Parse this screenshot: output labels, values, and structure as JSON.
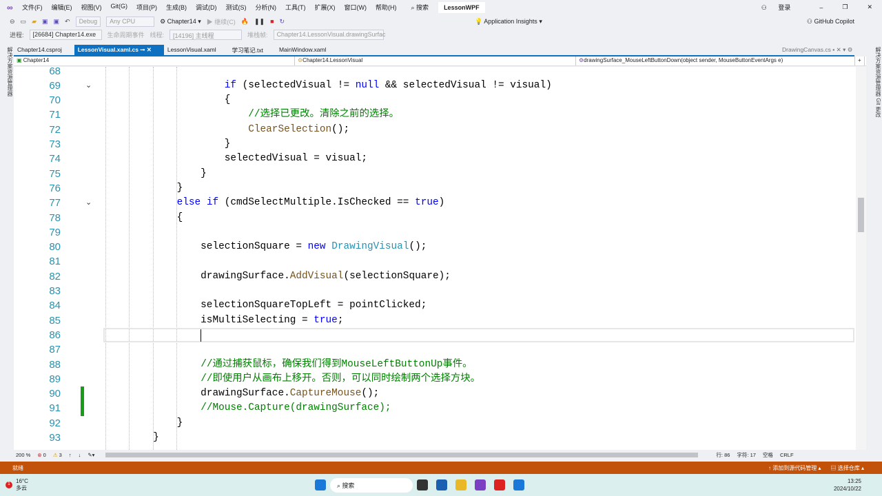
{
  "menu": {
    "items": [
      "文件(F)",
      "编辑(E)",
      "视图(V)",
      "Git(G)",
      "项目(P)",
      "生成(B)",
      "调试(D)",
      "测试(S)",
      "分析(N)",
      "工具(T)",
      "扩展(X)",
      "窗口(W)",
      "帮助(H)"
    ],
    "search": "搜索",
    "solution": "LessonWPF",
    "signin": "登录"
  },
  "toolbar": {
    "config": "Debug",
    "platform": "Any CPU",
    "project": "Chapter14",
    "continue": "继续(C)",
    "app_insights": "Application Insights",
    "copilot": "GitHub Copilot"
  },
  "toolbar2": {
    "process_label": "进程:",
    "process": "[26684] Chapter14.exe",
    "lifecycle": "生命周期事件",
    "thread_label": "线程:",
    "thread": "[14196] 主线程",
    "stackframe_label": "堆栈帧:",
    "stackframe": "Chapter14.LessonVisual.drawingSurfac"
  },
  "tabs": [
    {
      "label": "Chapter14.csproj"
    },
    {
      "label": "LessonVisual.xaml.cs",
      "active": true
    },
    {
      "label": "LessonVisual.xaml"
    },
    {
      "label": "学习笔记.txt"
    },
    {
      "label": "MainWindow.xaml"
    }
  ],
  "preview_tab": "DrawingCanvas.cs",
  "nav": {
    "project": "Chapter14",
    "class": "Chapter14.LessonVisual",
    "member": "drawingSurface_MouseLeftButtonDown(object sender, MouseButtonEventArgs e)"
  },
  "left_strip": "解决方案资源管理器",
  "right_strip": "解决方案资源管理器 Git 更改",
  "code": [
    {
      "n": "68",
      "t": []
    },
    {
      "n": "69",
      "fold": true,
      "t": [
        [
          "                    ",
          "pl"
        ],
        [
          "if",
          "kw"
        ],
        [
          " (selectedVisual != ",
          "pl"
        ],
        [
          "null",
          "kw"
        ],
        [
          " && selectedVisual != ",
          "pl"
        ],
        [
          "visual",
          "pl"
        ],
        [
          ")",
          "pl"
        ]
      ]
    },
    {
      "n": "70",
      "t": [
        [
          "                    {",
          "pl"
        ]
      ]
    },
    {
      "n": "71",
      "t": [
        [
          "                        ",
          "pl"
        ],
        [
          "//选择已更改。清除之前的选择。",
          "cm"
        ]
      ]
    },
    {
      "n": "72",
      "t": [
        [
          "                        ",
          "pl"
        ],
        [
          "ClearSelection",
          "fn"
        ],
        [
          "();",
          "pl"
        ]
      ]
    },
    {
      "n": "73",
      "t": [
        [
          "                    }",
          "pl"
        ]
      ]
    },
    {
      "n": "74",
      "t": [
        [
          "                    selectedVisual = visual;",
          "pl"
        ]
      ]
    },
    {
      "n": "75",
      "t": [
        [
          "                }",
          "pl"
        ]
      ]
    },
    {
      "n": "76",
      "t": [
        [
          "            }",
          "pl"
        ]
      ]
    },
    {
      "n": "77",
      "fold": true,
      "t": [
        [
          "            ",
          "pl"
        ],
        [
          "else if",
          "kw"
        ],
        [
          " (cmdSelectMultiple.IsChecked == ",
          "pl"
        ],
        [
          "true",
          "kw"
        ],
        [
          ")",
          "pl"
        ]
      ]
    },
    {
      "n": "78",
      "t": [
        [
          "            {",
          "pl"
        ]
      ]
    },
    {
      "n": "79",
      "t": []
    },
    {
      "n": "80",
      "t": [
        [
          "                selectionSquare = ",
          "pl"
        ],
        [
          "new",
          "kw"
        ],
        [
          " ",
          "pl"
        ],
        [
          "DrawingVisual",
          "ty"
        ],
        [
          "();",
          "pl"
        ]
      ]
    },
    {
      "n": "81",
      "t": []
    },
    {
      "n": "82",
      "t": [
        [
          "                drawingSurface.",
          "pl"
        ],
        [
          "AddVisual",
          "fn"
        ],
        [
          "(selectionSquare);",
          "pl"
        ]
      ]
    },
    {
      "n": "83",
      "t": []
    },
    {
      "n": "84",
      "t": [
        [
          "                selectionSquareTopLeft = pointClicked;",
          "pl"
        ]
      ]
    },
    {
      "n": "85",
      "t": [
        [
          "                isMultiSelecting = ",
          "pl"
        ],
        [
          "true",
          "kw"
        ],
        [
          ";",
          "pl"
        ]
      ]
    },
    {
      "n": "86",
      "current": true,
      "t": []
    },
    {
      "n": "87",
      "t": []
    },
    {
      "n": "88",
      "t": [
        [
          "                ",
          "pl"
        ],
        [
          "//通过捕获鼠标，确保我们得到MouseLeftButtonUp事件。",
          "cm"
        ]
      ]
    },
    {
      "n": "89",
      "t": [
        [
          "                ",
          "pl"
        ],
        [
          "//即使用户从画布上移开。否则，可以同时绘制两个选择方块。",
          "cm"
        ]
      ]
    },
    {
      "n": "90",
      "changed": true,
      "t": [
        [
          "                drawingSurface.",
          "pl"
        ],
        [
          "CaptureMouse",
          "fn"
        ],
        [
          "();",
          "pl"
        ]
      ]
    },
    {
      "n": "91",
      "changed": true,
      "t": [
        [
          "                ",
          "pl"
        ],
        [
          "//Mouse.Capture(drawingSurface);",
          "cm"
        ]
      ]
    },
    {
      "n": "92",
      "t": [
        [
          "            }",
          "pl"
        ]
      ]
    },
    {
      "n": "93",
      "t": [
        [
          "        }",
          "pl"
        ]
      ]
    }
  ],
  "status": {
    "zoom": "200 %",
    "errors": "0",
    "warnings": "3",
    "line": "行: 86",
    "char": "字符: 17",
    "spaces": "空格",
    "eol": "CRLF"
  },
  "bottom": {
    "ready": "就绪",
    "add_source": "添加到源代码管理",
    "select_repo": "选择仓库"
  },
  "taskbar": {
    "temp": "16°C",
    "weather": "多云",
    "badge": "1",
    "search": "搜索",
    "time": "13:25",
    "date": "2024/10/22"
  },
  "colors": {
    "accent": "#0e70c0",
    "statusbar": "#c2510a",
    "keyword": "#0000ff",
    "type": "#2b91af",
    "comment": "#008000",
    "method": "#74531f"
  }
}
